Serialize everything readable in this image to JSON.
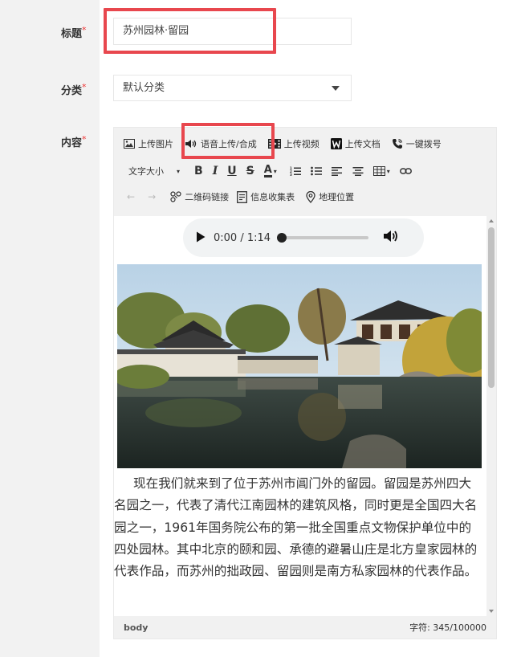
{
  "form": {
    "title_label": "标题",
    "category_label": "分类",
    "content_label": "内容",
    "required_mark": "*",
    "title_value": "苏州园林·留园",
    "category_value": "默认分类"
  },
  "toolbar": {
    "row1": {
      "upload_image": "上传图片",
      "voice_upload": "语音上传/合成",
      "upload_video": "上传视频",
      "upload_doc": "上传文档",
      "one_key_dial": "一键拨号"
    },
    "row2": {
      "font_size": "文字大小"
    },
    "row3": {
      "qr_link": "二维码链接",
      "info_collect": "信息收集表",
      "location": "地理位置"
    }
  },
  "audio": {
    "time": "0:00 / 1:14",
    "progress": 0
  },
  "article": {
    "text": "现在我们就来到了位于苏州市阊门外的留园。留园是苏州四大名园之一，代表了清代江南园林的建筑风格，同时更是全国四大名园之一，1961年国务院公布的第一批全国重点文物保护单位中的四处园林。其中北京的颐和园、承德的避暑山庄是北方皇家园林的代表作品，而苏州的拙政园、留园则是南方私家园林的代表作品。"
  },
  "status": {
    "path": "body",
    "char_count": "字符: 345/100000"
  },
  "colors": {
    "highlight": "#e8474e",
    "required": "#ee3333"
  }
}
